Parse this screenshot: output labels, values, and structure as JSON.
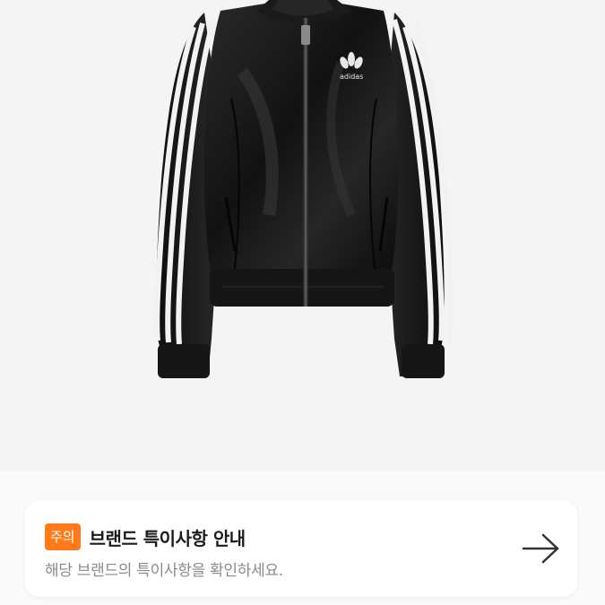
{
  "product": {
    "image_alt": "adidas black faux leather track jacket",
    "logo_text": "adidas"
  },
  "notice": {
    "badge": "주의",
    "title": "브랜드 특이사항 안내",
    "description": "해당 브랜드의 특이사항을 확인하세요.",
    "arrow_icon": "arrow-right-icon"
  },
  "colors": {
    "badge_bg": "#ff7a1a",
    "jacket": "#141414",
    "stripe": "#f2f2f2"
  }
}
